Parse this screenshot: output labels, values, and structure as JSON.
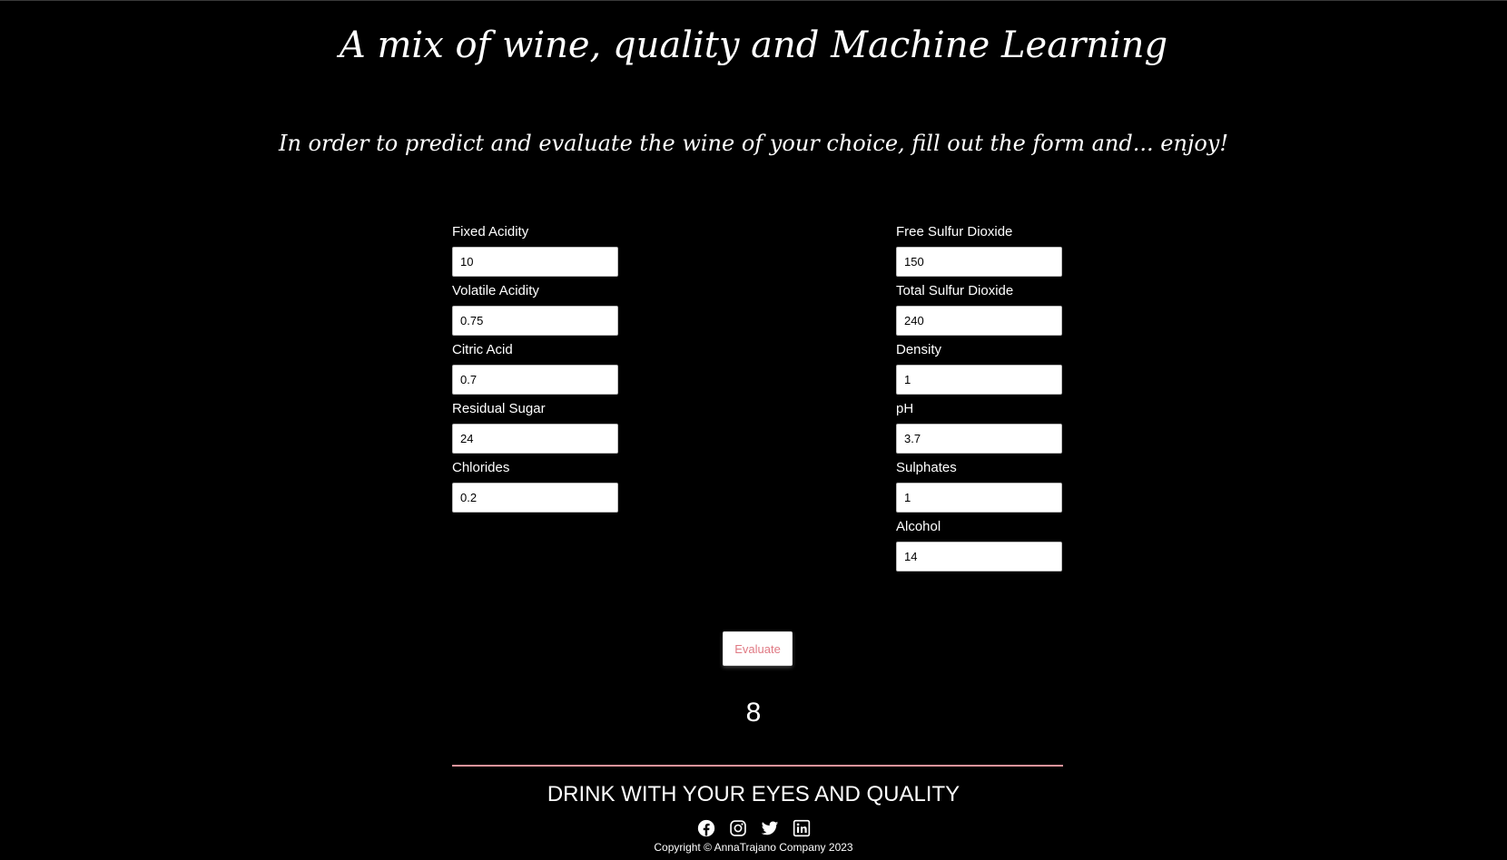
{
  "header": {
    "title": "A mix of wine, quality and Machine Learning",
    "subtitle": "In order to predict and evaluate the wine of your choice, fill out the form and... enjoy!"
  },
  "form": {
    "left_fields": [
      {
        "label": "Fixed Acidity",
        "value": "10"
      },
      {
        "label": "Volatile Acidity",
        "value": "0.75"
      },
      {
        "label": "Citric Acid",
        "value": "0.7"
      },
      {
        "label": "Residual Sugar",
        "value": "24"
      },
      {
        "label": "Chlorides",
        "value": "0.2"
      }
    ],
    "right_fields": [
      {
        "label": "Free Sulfur Dioxide",
        "value": "150"
      },
      {
        "label": "Total Sulfur Dioxide",
        "value": "240"
      },
      {
        "label": "Density",
        "value": "1"
      },
      {
        "label": "pH",
        "value": "3.7"
      },
      {
        "label": "Sulphates",
        "value": "1"
      },
      {
        "label": "Alcohol",
        "value": "14"
      }
    ],
    "evaluate_label": "Evaluate"
  },
  "result": {
    "value": "8"
  },
  "footer": {
    "heading": "DRINK WITH YOUR EYES AND QUALITY",
    "social": [
      "facebook-icon",
      "instagram-icon",
      "twitter-icon",
      "linkedin-icon"
    ],
    "copyright": "Copyright © AnnaTrajano Company 2023"
  },
  "colors": {
    "background": "#000000",
    "accent": "#e8949b",
    "button_text": "#e07a84"
  }
}
